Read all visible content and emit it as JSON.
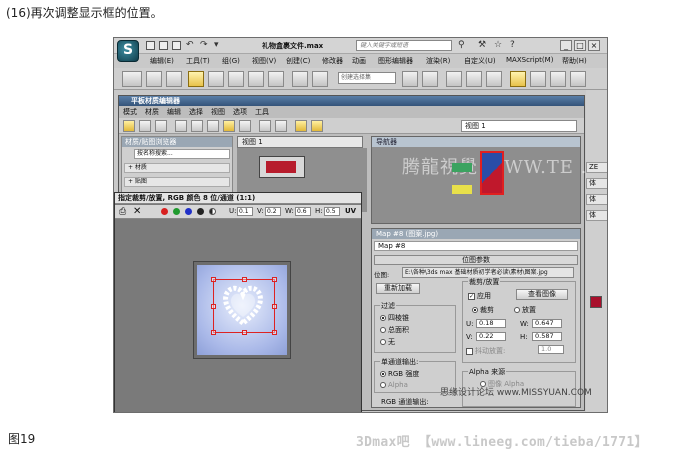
{
  "caption": "(16)再次调整显示框的位置。",
  "figure_label": "图19",
  "footer": "3Dmax吧 【www.lineeg.com/tieba/1771】",
  "watermark_bottom": "思缘设计论坛 www.MISSYUAN.COM",
  "app": {
    "title": "礼物盒裹文件.max",
    "search_placeholder": "键入关键字或短语",
    "menus": [
      "编辑(E)",
      "工具(T)",
      "组(G)",
      "视图(V)",
      "创建(C)",
      "修改器",
      "动画",
      "图形编辑器",
      "渲染(R)",
      "自定义(U)",
      "MAXScript(M)",
      "帮助(H)"
    ],
    "selection_set_placeholder": "创建选择集",
    "window_buttons": [
      "_",
      "□",
      "×"
    ]
  },
  "slate": {
    "title": "平板材质编辑器",
    "menus": [
      "模式",
      "材质",
      "编辑",
      "选择",
      "视图",
      "选项",
      "工具"
    ],
    "view_select": "视图 1",
    "browser_title": "材质/贴图浏览器",
    "browser_search": "按名称搜索...",
    "browser_rows": [
      "+ 材质",
      "+ 贴图"
    ],
    "view_tab": "视图 1",
    "navigator_title": "导航器",
    "navigator_watermark": "腾龍視覺 WWW.TE .NET",
    "params_title": "Map #8 (图案.jpg)",
    "map_name": "Map #8",
    "rollout_title": "位图参数",
    "bitmap_label": "位图:",
    "bitmap_path": "E:\\各种\\3ds max 基础材质初学者必读\\素材\\图案.jpg",
    "reload_button": "重新加载",
    "crop_group": "裁剪/放置",
    "apply_label": "应用",
    "view_image_button": "查看图像",
    "crop_radio": "裁剪",
    "place_radio": "放置",
    "u_label": "U:",
    "u_value": "0.18",
    "w_label": "W:",
    "w_value": "0.647",
    "v_label": "V:",
    "v_value": "0.22",
    "h_label": "H:",
    "h_value": "0.587",
    "jitter_label": "抖动放置:",
    "jitter_value": "1.0",
    "filter_group": "过滤",
    "filter_options": [
      "四棱锥",
      "总面积",
      "无"
    ],
    "mono_group": "单通道输出:",
    "mono_options": [
      "RGB 强度",
      "Alpha"
    ],
    "rgb_group": "RGB 通道输出:",
    "alpha_group": "Alpha 来源",
    "alpha_options": [
      "图像 Alpha"
    ]
  },
  "crop_window": {
    "title": "指定裁剪/放置, RGB 颜色 8 位/通道 (1:1)",
    "u_label": "U:",
    "u_value": "0.1",
    "v_label": "V:",
    "v_value": "0.2",
    "w_label": "W:",
    "w_value": "0.6",
    "h_label": "H:",
    "h_value": "0.5",
    "uv_label": "UV",
    "channel_colors": [
      "#d82020",
      "#1f9a2e",
      "#2030c8",
      "#222222"
    ]
  },
  "command_panel": {
    "rows": [
      "ZE",
      "体",
      "体",
      "体"
    ]
  }
}
